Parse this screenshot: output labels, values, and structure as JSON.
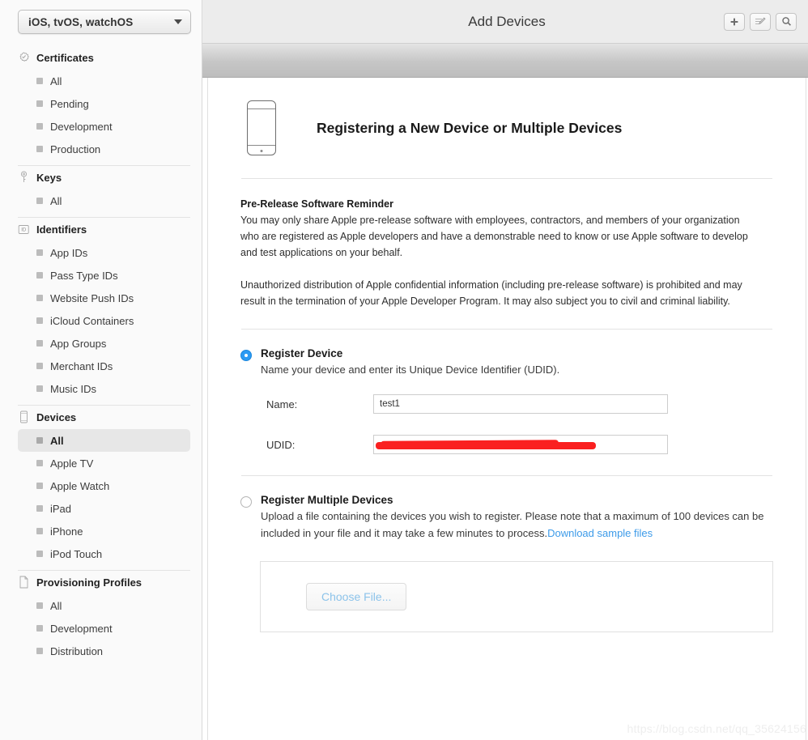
{
  "sidebar": {
    "platform_selector": {
      "value": "iOS, tvOS, watchOS"
    },
    "groups": [
      {
        "title": "Certificates",
        "icon": "certificate-badge-icon",
        "items": [
          {
            "label": "All",
            "selected": false
          },
          {
            "label": "Pending",
            "selected": false
          },
          {
            "label": "Development",
            "selected": false
          },
          {
            "label": "Production",
            "selected": false
          }
        ]
      },
      {
        "title": "Keys",
        "icon": "key-icon",
        "items": [
          {
            "label": "All",
            "selected": false
          }
        ]
      },
      {
        "title": "Identifiers",
        "icon": "id-badge-icon",
        "items": [
          {
            "label": "App IDs",
            "selected": false
          },
          {
            "label": "Pass Type IDs",
            "selected": false
          },
          {
            "label": "Website Push IDs",
            "selected": false
          },
          {
            "label": "iCloud Containers",
            "selected": false
          },
          {
            "label": "App Groups",
            "selected": false
          },
          {
            "label": "Merchant IDs",
            "selected": false
          },
          {
            "label": "Music IDs",
            "selected": false
          }
        ]
      },
      {
        "title": "Devices",
        "icon": "device-phone-icon",
        "items": [
          {
            "label": "All",
            "selected": true
          },
          {
            "label": "Apple TV",
            "selected": false
          },
          {
            "label": "Apple Watch",
            "selected": false
          },
          {
            "label": "iPad",
            "selected": false
          },
          {
            "label": "iPhone",
            "selected": false
          },
          {
            "label": "iPod Touch",
            "selected": false
          }
        ]
      },
      {
        "title": "Provisioning Profiles",
        "icon": "document-icon",
        "items": [
          {
            "label": "All",
            "selected": false
          },
          {
            "label": "Development",
            "selected": false
          },
          {
            "label": "Distribution",
            "selected": false
          }
        ]
      }
    ]
  },
  "topbar": {
    "title": "Add Devices",
    "actions": [
      {
        "name": "add-button",
        "icon": "plus-icon"
      },
      {
        "name": "edit-button",
        "icon": "edit-pencil-icon"
      },
      {
        "name": "search-button",
        "icon": "search-icon"
      }
    ]
  },
  "main": {
    "heading": "Registering a New Device or Multiple Devices",
    "prerelease": {
      "title": "Pre-Release Software Reminder",
      "paragraph1": "You may only share Apple pre-release software with employees, contractors, and members of your organization who are registered as Apple developers and have a demonstrable need to know or use Apple software to develop and test applications on your behalf.",
      "paragraph2": "Unauthorized distribution of Apple confidential information (including pre-release software) is prohibited and may result in the termination of your Apple Developer Program. It may also subject you to civil and criminal liability."
    },
    "register_device": {
      "title": "Register Device",
      "description": "Name your device and enter its Unique Device Identifier (UDID).",
      "selected": true,
      "fields": [
        {
          "label": "Name:",
          "value": "test1",
          "redacted": false
        },
        {
          "label": "UDID:",
          "value": "",
          "redacted": true
        }
      ]
    },
    "register_multiple": {
      "title": "Register Multiple Devices",
      "selected": false,
      "description": "Upload a file containing the devices you wish to register. Please note that a maximum of 100 devices can be included in your file and it may take a few minutes to process.",
      "link_label": "Download sample files",
      "choose_file_label": "Choose File..."
    }
  },
  "watermark": "https://blog.csdn.net/qq_35624156",
  "colors": {
    "accent_blue": "#2b9af3",
    "link_blue": "#3d9be9",
    "redaction_red": "#fa2020",
    "sidebar_bg": "#fafafa",
    "topbar_bg": "#ececec"
  }
}
